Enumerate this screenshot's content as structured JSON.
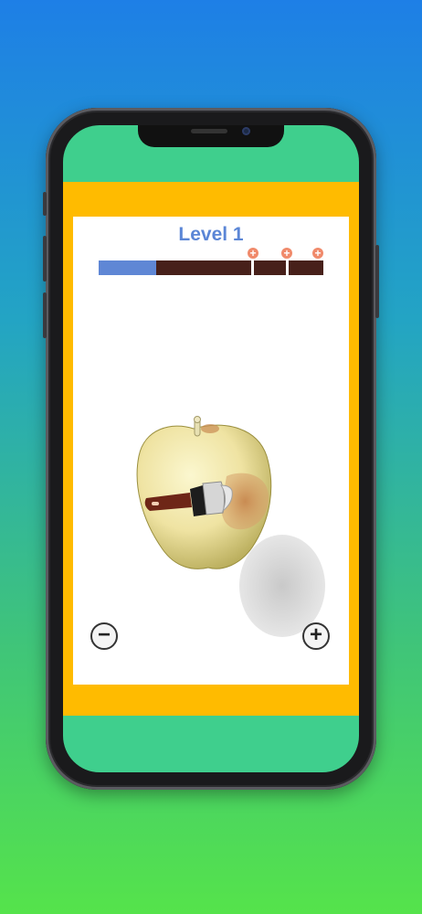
{
  "game": {
    "level_title": "Level 1",
    "progress": {
      "segments": 3,
      "filled_fraction_of_first_segment": 0.38,
      "fill_color": "#5f87d5",
      "track_color": "#47201a",
      "checkpoint_markers": 3
    },
    "object": "apple",
    "tool": "paint-brush",
    "controls": {
      "zoom_out_symbol": "−",
      "zoom_in_symbol": "+"
    }
  },
  "colors": {
    "frame": "#ffbb00",
    "title": "#5b86d6",
    "marker": "#f08a6b"
  }
}
